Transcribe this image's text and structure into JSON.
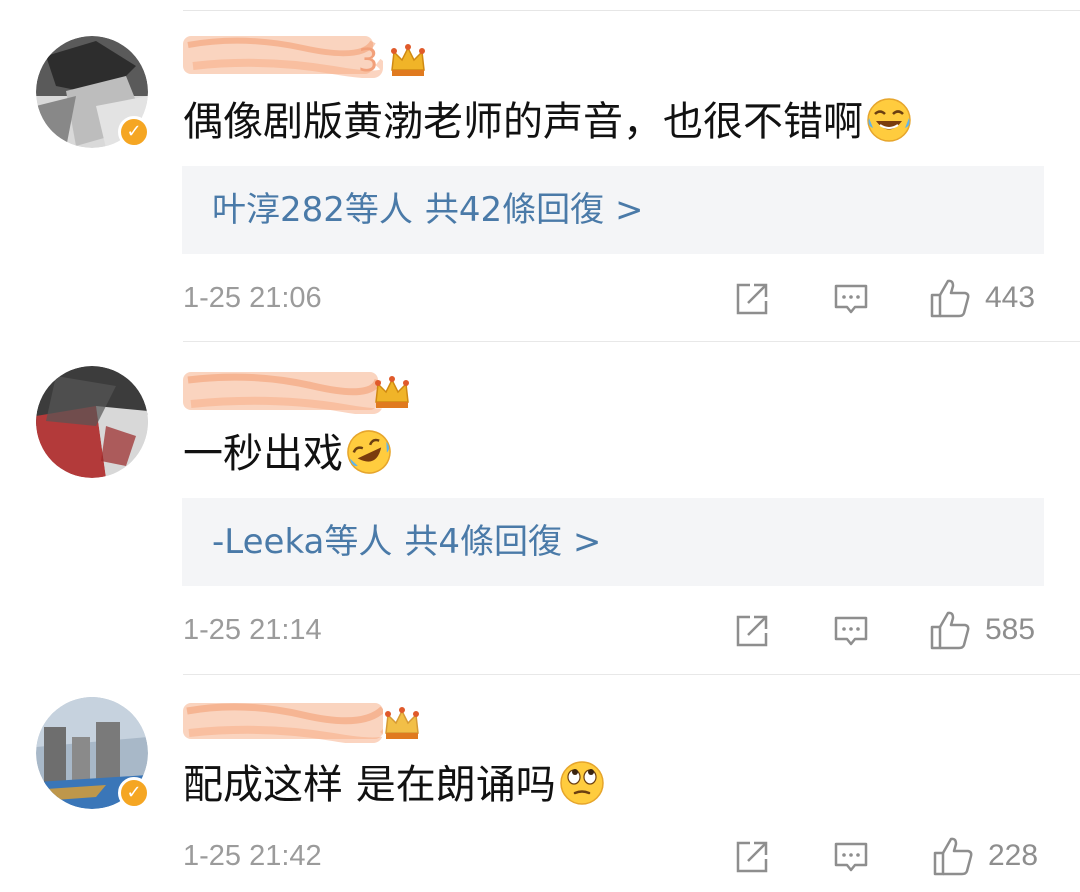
{
  "colors": {
    "link_blue": "#4a7aa8",
    "meta_gray": "#9b9b9b",
    "reply_bg": "#f4f5f7",
    "verified_orange": "#f5a623",
    "crown_gold": "#f0b428",
    "blurred_name": "#f6b08a"
  },
  "comments": [
    {
      "username_tail": "3",
      "text": "偶像剧版黄渤老师的声音，也很不错啊",
      "emoji": "laughing-tears-emoji",
      "replies": {
        "users": "叶淳282等人",
        "summary": "共42條回復 >"
      },
      "timestamp": "1-25 21:06",
      "likes": "443",
      "verified": true
    },
    {
      "username_tail": "",
      "text": "一秒出戏",
      "emoji": "rolling-laughing-emoji",
      "replies": {
        "users": "-Leeka等人",
        "summary": "共4條回復 >"
      },
      "timestamp": "1-25 21:14",
      "likes": "585",
      "verified": false
    },
    {
      "username_tail": "",
      "text": "配成这样 是在朗诵吗",
      "emoji": "eye-roll-emoji",
      "replies": null,
      "timestamp": "1-25 21:42",
      "likes": "228",
      "verified": true
    }
  ],
  "icons": {
    "share": "share-icon",
    "comment": "comment-icon",
    "like": "thumbs-up-icon",
    "crown": "crown-badge-icon",
    "verified": "verified-badge-icon"
  }
}
